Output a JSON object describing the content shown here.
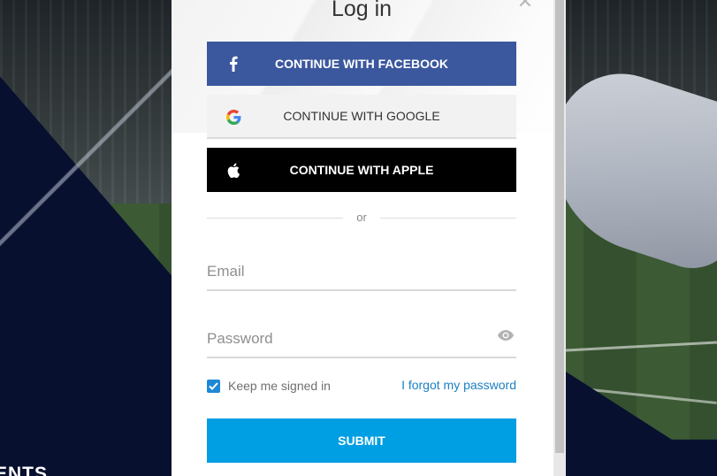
{
  "background": {
    "section_label": "ENTS"
  },
  "modal": {
    "title": "Log in",
    "close_icon": "close-icon",
    "social": {
      "facebook_label": "CONTINUE WITH FACEBOOK",
      "google_label": "CONTINUE WITH GOOGLE",
      "apple_label": "CONTINUE WITH APPLE"
    },
    "divider_text": "or",
    "email": {
      "placeholder": "Email",
      "value": ""
    },
    "password": {
      "placeholder": "Password",
      "value": ""
    },
    "remember_label": "Keep me signed in",
    "remember_checked": true,
    "forgot_label": "I forgot my password",
    "submit_label": "SUBMIT"
  },
  "colors": {
    "facebook": "#3b579d",
    "apple": "#000000",
    "google_bg": "#f2f2f2",
    "submit": "#009ee2",
    "link": "#1c7fc2",
    "checkbox": "#1e88d6"
  }
}
